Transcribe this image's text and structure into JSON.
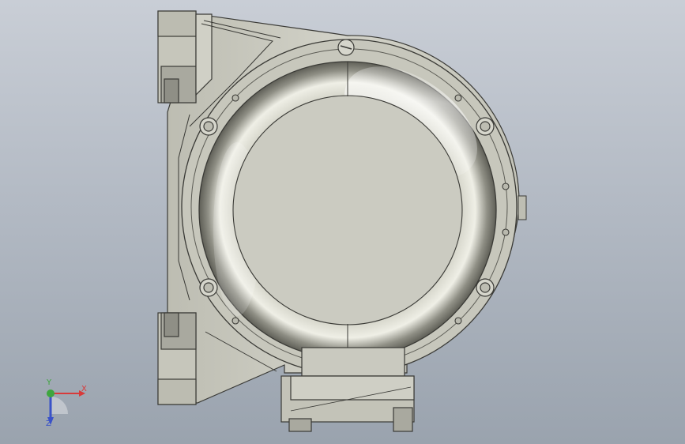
{
  "viewport": {
    "background_top": "#c9ced6",
    "background_bottom": "#9aa3ae",
    "model": "motor-housing-front-view"
  },
  "triad": {
    "x_label": "X",
    "y_label": "Y",
    "z_label": "Z",
    "x_color": "#d83a3a",
    "y_color": "#3ea63e",
    "z_color": "#3a52c8"
  },
  "colors": {
    "metal_face": "#cfcfc4",
    "metal_dark": "#8e8e84",
    "outline": "#3a3a36"
  }
}
